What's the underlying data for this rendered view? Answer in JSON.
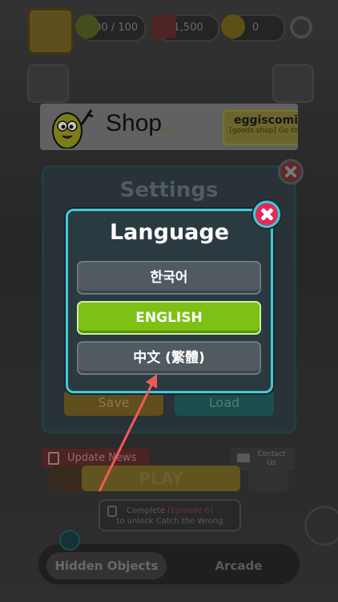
{
  "topbar": {
    "energy": "100 / 100",
    "cards": "1,500",
    "coins": "0"
  },
  "shop": {
    "title": "Shop",
    "brand": "eggiscoming",
    "subtitle": "[goods shop] Go to Shop"
  },
  "settings": {
    "title": "Settings",
    "save_label": "Save",
    "load_label": "Load"
  },
  "bottom": {
    "update_news": "Update News",
    "contact_line1": "Contact",
    "contact_line2": "Us",
    "play": "PLAY",
    "unlock_prefix": "Complete ",
    "unlock_highlight": "[Episode 6]",
    "unlock_line2": "to unlock Catch the Wrong",
    "nav_hidden_objects": "Hidden Objects",
    "nav_arcade": "Arcade"
  },
  "language_dialog": {
    "title": "Language",
    "options": [
      "한국어",
      "ENGLISH",
      "中文 (繁體)"
    ],
    "selected_index": 1
  },
  "colors": {
    "accent_cyan": "#41c9d6",
    "selected_green": "#7cc114",
    "close_pink": "#e22a58",
    "arrow_red": "#f25a5a"
  }
}
